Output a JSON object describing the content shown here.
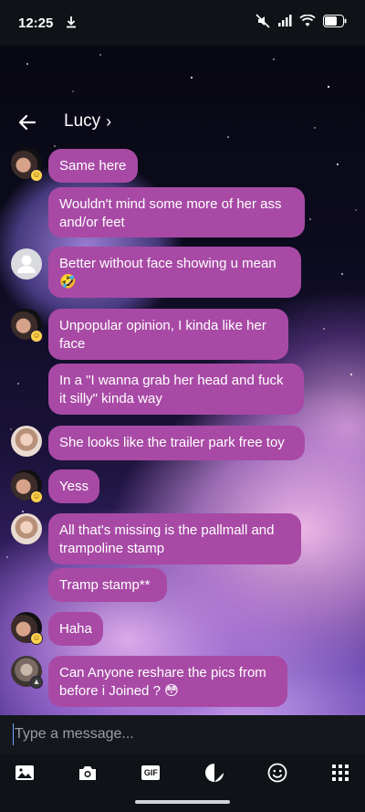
{
  "status": {
    "time": "12:25",
    "download_icon": "download-icon",
    "mute_icon": "mute-icon",
    "signal_icon": "signal-icon",
    "wifi_icon": "wifi-icon",
    "battery_icon": "battery-icon"
  },
  "header": {
    "title": "Lucy",
    "chevron": "›"
  },
  "messages": [
    {
      "text": "Same here",
      "avatar": "dark"
    },
    {
      "text": "Wouldn't mind some more of her ass and/or feet",
      "avatar": null
    },
    {
      "text": "Better without face showing u mean 🤣",
      "avatar": "grey"
    },
    {
      "text": "Unpopular opinion, I kinda like her face",
      "avatar": "dark"
    },
    {
      "text": "In a \"I wanna grab her head and fuck it silly\" kinda way",
      "avatar": null
    },
    {
      "text": "She looks like the trailer park free toy",
      "avatar": "light"
    },
    {
      "text": "Yess",
      "avatar": "dark"
    },
    {
      "text": "All that's missing is the pallmall and trampoline stamp",
      "avatar": "light"
    },
    {
      "text": "Tramp stamp**",
      "avatar": null
    },
    {
      "text": "Haha",
      "avatar": "dark"
    },
    {
      "text": "Can Anyone reshare the pics from before i Joined ? 😳",
      "avatar": "dim"
    }
  ],
  "composer": {
    "placeholder": "Type a message..."
  },
  "toolbar": {
    "gif_label": "GIF",
    "icons": [
      "image-icon",
      "camera-icon",
      "gif-icon",
      "sticker-icon",
      "emoji-icon",
      "apps-grid-icon"
    ]
  },
  "colors": {
    "bubble": "#a84aa5",
    "bar": "#0f1216"
  }
}
